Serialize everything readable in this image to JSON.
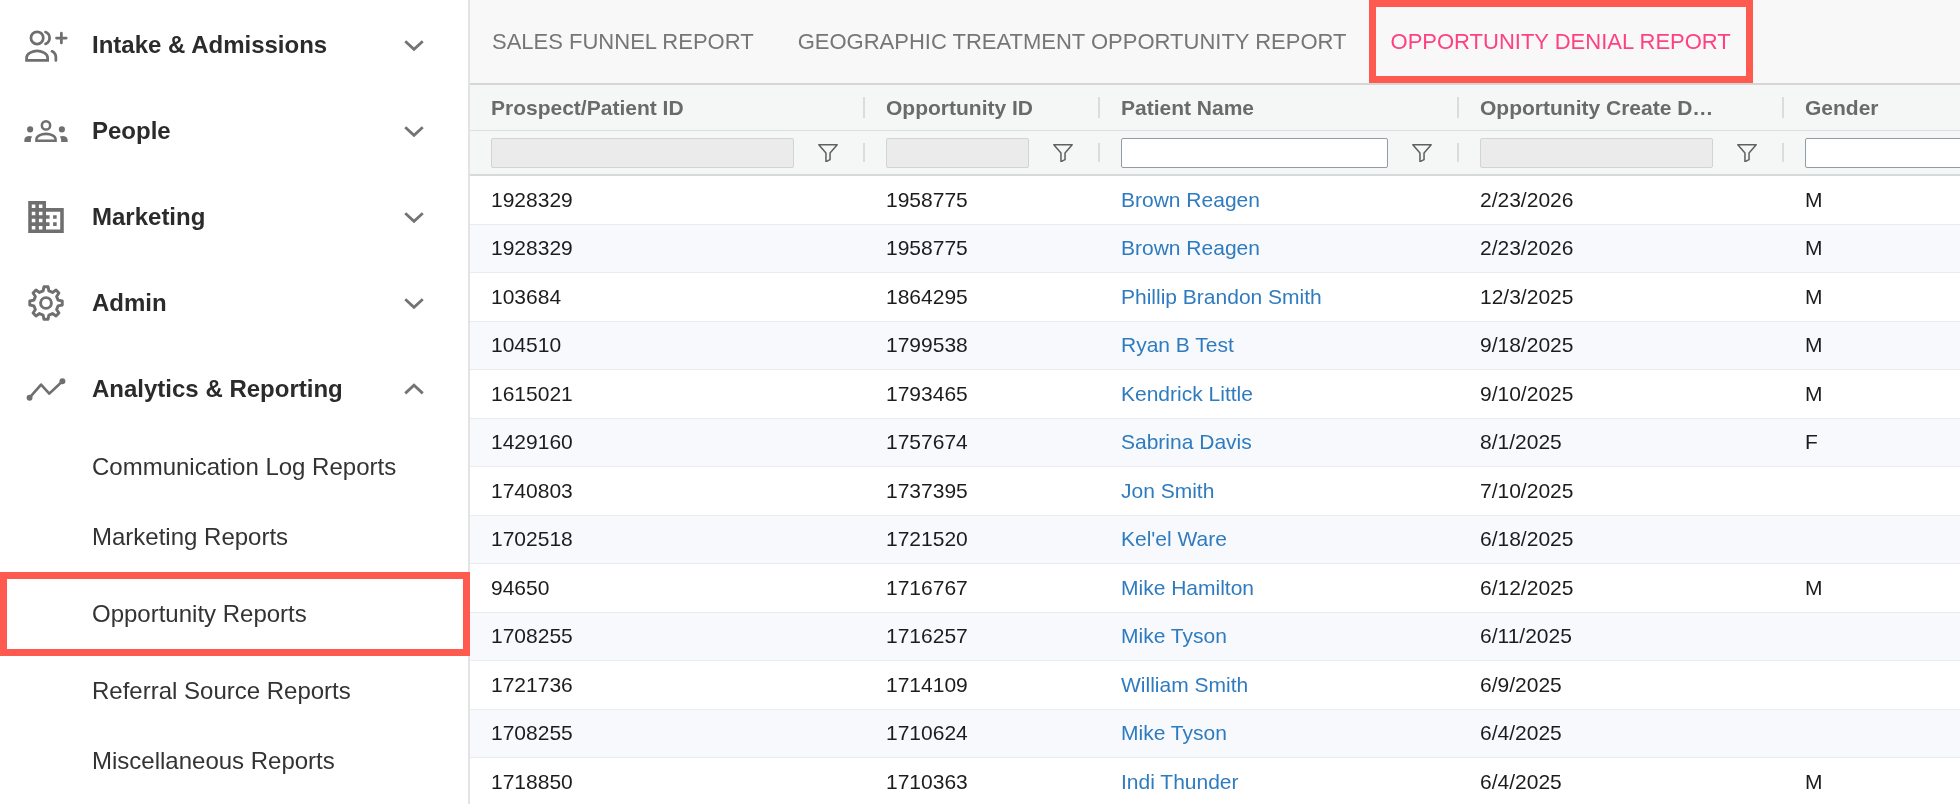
{
  "sidebar": {
    "items": [
      {
        "label": "Intake & Admissions",
        "expanded": false
      },
      {
        "label": "People",
        "expanded": false
      },
      {
        "label": "Marketing",
        "expanded": false
      },
      {
        "label": "Admin",
        "expanded": false
      },
      {
        "label": "Analytics & Reporting",
        "expanded": true,
        "children": [
          {
            "label": "Communication Log Reports",
            "highlighted": false
          },
          {
            "label": "Marketing Reports",
            "highlighted": false
          },
          {
            "label": "Opportunity Reports",
            "highlighted": true
          },
          {
            "label": "Referral Source Reports",
            "highlighted": false
          },
          {
            "label": "Miscellaneous Reports",
            "highlighted": false
          }
        ]
      }
    ]
  },
  "tabs": [
    {
      "label": "SALES FUNNEL REPORT",
      "selected": false,
      "highlighted": false
    },
    {
      "label": "GEOGRAPHIC TREATMENT OPPORTUNITY REPORT",
      "selected": false,
      "highlighted": false
    },
    {
      "label": "OPPORTUNITY DENIAL REPORT",
      "selected": true,
      "highlighted": true
    }
  ],
  "table": {
    "columns": [
      {
        "label": "Prospect/Patient ID",
        "kind": "text",
        "filter": {
          "disabled": true
        }
      },
      {
        "label": "Opportunity ID",
        "kind": "text",
        "filter": {
          "disabled": true
        }
      },
      {
        "label": "Patient Name",
        "kind": "link",
        "filter": {
          "disabled": false
        }
      },
      {
        "label": "Opportunity Create D…",
        "kind": "text",
        "filter": {
          "disabled": true
        }
      },
      {
        "label": "Gender",
        "kind": "text",
        "filter": {
          "disabled": false
        }
      }
    ],
    "rows": [
      [
        "1928329",
        "1958775",
        "Brown Reagen",
        "2/23/2026",
        "M"
      ],
      [
        "1928329",
        "1958775",
        "Brown Reagen",
        "2/23/2026",
        "M"
      ],
      [
        "103684",
        "1864295",
        "Phillip Brandon Smith",
        "12/3/2025",
        "M"
      ],
      [
        "104510",
        "1799538",
        "Ryan B Test",
        "9/18/2025",
        "M"
      ],
      [
        "1615021",
        "1793465",
        "Kendrick Little",
        "9/10/2025",
        "M"
      ],
      [
        "1429160",
        "1757674",
        "Sabrina Davis",
        "8/1/2025",
        "F"
      ],
      [
        "1740803",
        "1737395",
        "Jon Smith",
        "7/10/2025"
      ],
      [
        "1702518",
        "1721520",
        "Kel'el Ware",
        "6/18/2025"
      ],
      [
        "94650",
        "1716767",
        "Mike Hamilton",
        "6/12/2025",
        "M"
      ],
      [
        "1708255",
        "1716257",
        "Mike Tyson",
        "6/11/2025"
      ],
      [
        "1721736",
        "1714109",
        "William Smith",
        "6/9/2025"
      ],
      [
        "1708255",
        "1710624",
        "Mike Tyson",
        "6/4/2025"
      ],
      [
        "1718850",
        "1710363",
        "Indi Thunder",
        "6/4/2025",
        "M"
      ]
    ]
  }
}
